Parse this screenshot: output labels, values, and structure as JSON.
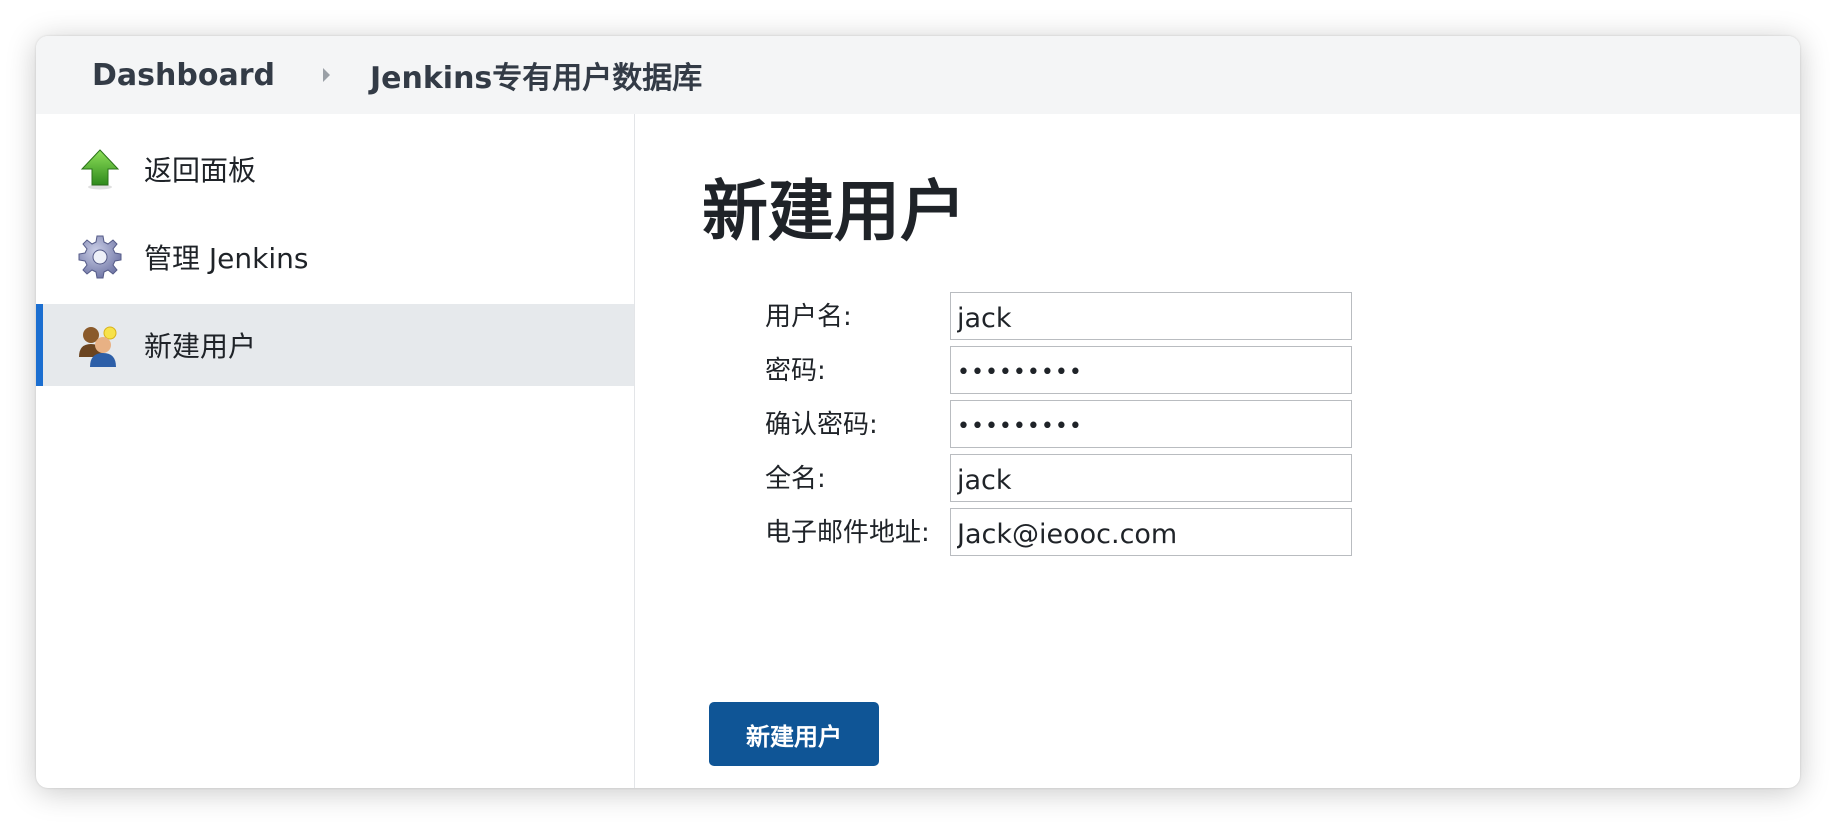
{
  "breadcrumb": {
    "home": "Dashboard",
    "current": "Jenkins专有用户数据库"
  },
  "sidebar": {
    "items": [
      {
        "label": "返回面板",
        "icon": "up-arrow-icon",
        "active": false
      },
      {
        "label": "管理 Jenkins",
        "icon": "gear-icon",
        "active": false
      },
      {
        "label": "新建用户",
        "icon": "new-user-icon",
        "active": true
      }
    ]
  },
  "main": {
    "title": "新建用户",
    "form": {
      "username": {
        "label": "用户名:",
        "value": "jack"
      },
      "password": {
        "label": "密码:",
        "value": "•••••••••"
      },
      "confirm_password": {
        "label": "确认密码:",
        "value": "•••••••••"
      },
      "fullname": {
        "label": "全名:",
        "value": "jack"
      },
      "email": {
        "label": "电子邮件地址:",
        "value": "Jack@ieooc.com"
      }
    },
    "submit_label": "新建用户"
  },
  "colors": {
    "accent": "#1b6ed0",
    "button": "#0f5596",
    "active_item_bg": "#e6e9ec",
    "breadcrumb_bg": "#f4f5f6"
  }
}
